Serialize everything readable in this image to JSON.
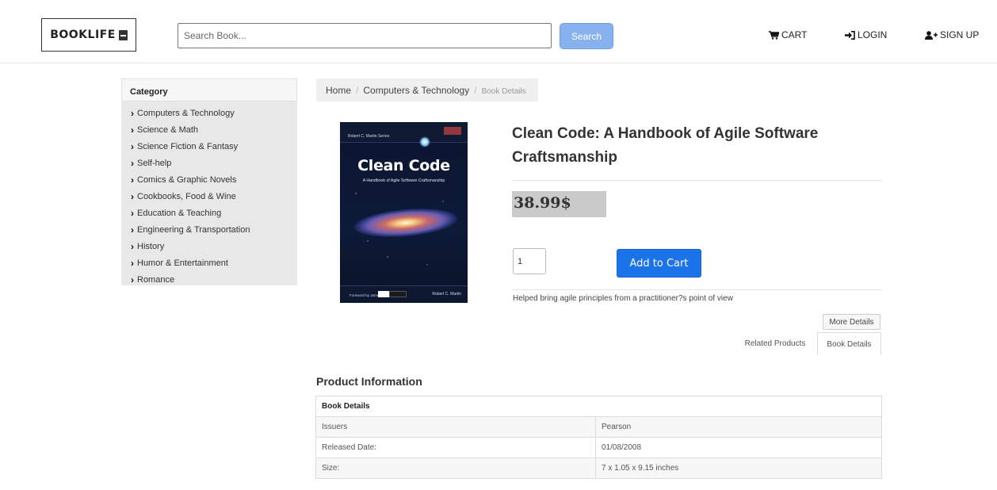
{
  "header": {
    "logo_text": "BOOKLIFE",
    "search_placeholder": "Search Book...",
    "search_button": "Search",
    "nav": {
      "cart": "CART",
      "login": "LOGIN",
      "signup": "SIGN UP"
    }
  },
  "sidebar": {
    "heading": "Category",
    "items": [
      "Computers & Technology",
      "Science & Math",
      "Science Fiction & Fantasy",
      "Self-help",
      "Comics & Graphic Novels",
      "Cookbooks, Food & Wine",
      "Education & Teaching",
      "Engineering & Transportation",
      "History",
      "Humor & Entertainment",
      "Romance"
    ]
  },
  "breadcrumb": {
    "home": "Home",
    "category": "Computers & Technology",
    "current": "Book Details"
  },
  "cover": {
    "author": "Robert C. Martin",
    "series": "Robert C. Martin Series",
    "title": "Clean Code",
    "subtitle": "A Handbook of Agile Software Craftsmanship",
    "foreword": "Foreword by James O. Coplien"
  },
  "product": {
    "title": "Clean Code: A Handbook of Agile Software Craftsmanship",
    "price": "38.99$",
    "quantity": "1",
    "add_to_cart": "Add to Cart",
    "tagline": "Helped bring agile principles from a practitioner?s point of view",
    "more_details": "More Details",
    "tabs": {
      "related": "Related Products",
      "details": "Book Details"
    }
  },
  "product_info": {
    "heading": "Product Information",
    "table_header": "Book Details",
    "rows": [
      {
        "label": "Issuers",
        "value": "Pearson"
      },
      {
        "label": "Released Date:",
        "value": "01/08/2008"
      },
      {
        "label": "Size:",
        "value": "7 x 1.05 x 9.15 inches"
      }
    ]
  },
  "colors": {
    "primary_button": "#1a73e8",
    "search_button": "#87b2ee",
    "price_bg": "#cacaca",
    "sidebar_bg": "#e8e8e8"
  },
  "icons": {
    "cart": "cart-icon",
    "login": "sign-in-icon",
    "signup": "user-plus-icon",
    "logo": "book-icon",
    "category_chevron": "chevron-right-icon"
  }
}
